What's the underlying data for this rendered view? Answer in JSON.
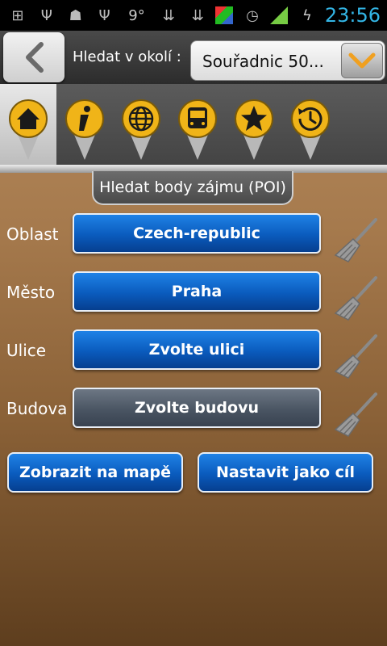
{
  "status_bar": {
    "temperature": "9°",
    "time": "23:56"
  },
  "header": {
    "search_near_label": "Hledat v okolí :",
    "search_near_value": "Souřadnic 50..."
  },
  "poi_tabs": [
    {
      "icon": "home-icon"
    },
    {
      "icon": "info-icon"
    },
    {
      "icon": "globe-icon"
    },
    {
      "icon": "bus-icon"
    },
    {
      "icon": "star-icon"
    },
    {
      "icon": "history-clock-icon"
    }
  ],
  "section_title": "Hledat body zájmu (POI)",
  "fields": [
    {
      "label": "Oblast",
      "value": "Czech-republic"
    },
    {
      "label": "Město",
      "value": "Praha"
    },
    {
      "label": "Ulice",
      "value": "Zvolte ulici"
    },
    {
      "label": "Budova",
      "value": "Zvolte budovu"
    }
  ],
  "actions": {
    "show_on_map": "Zobrazit na mapě",
    "set_destination": "Nastavit jako cíl"
  },
  "colors": {
    "accent_blue": "#0a5bbd",
    "pin_gold": "#f0b418",
    "time_blue": "#33b5e5"
  }
}
